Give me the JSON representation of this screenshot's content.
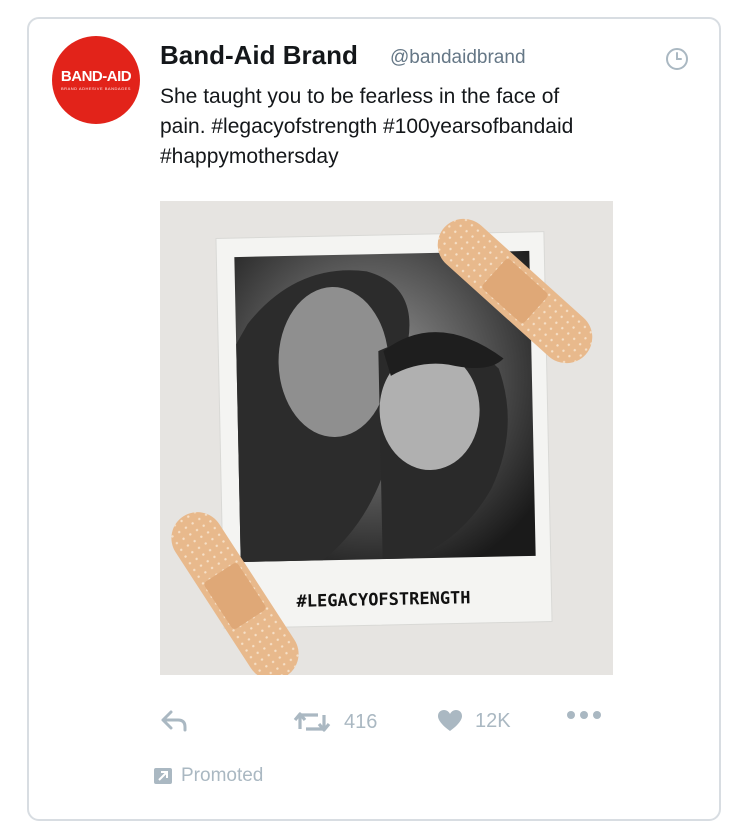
{
  "account": {
    "name": "Band-Aid Brand",
    "handle": "@bandaidbrand",
    "logo_text": "BAND-AID",
    "logo_subtext": "BRAND ADHESIVE BANDAGES",
    "brand_color": "#e2231a"
  },
  "tweet": {
    "text_line1": "She taught you to be fearless in the face of",
    "text_line2": "pain. #legacyofstrength #100yearsofbandaid",
    "text_line3": "#happymothersday"
  },
  "photo": {
    "caption": "#LEGACYOFSTRENGTH"
  },
  "actions": {
    "retweet_count": "416",
    "like_count": "12K",
    "icons": [
      "reply-icon",
      "retweet-icon",
      "heart-icon",
      "more-icon"
    ]
  },
  "promoted_label": "Promoted",
  "colors": {
    "text": "#14171a",
    "muted": "#657786",
    "action": "#aab8c2"
  }
}
